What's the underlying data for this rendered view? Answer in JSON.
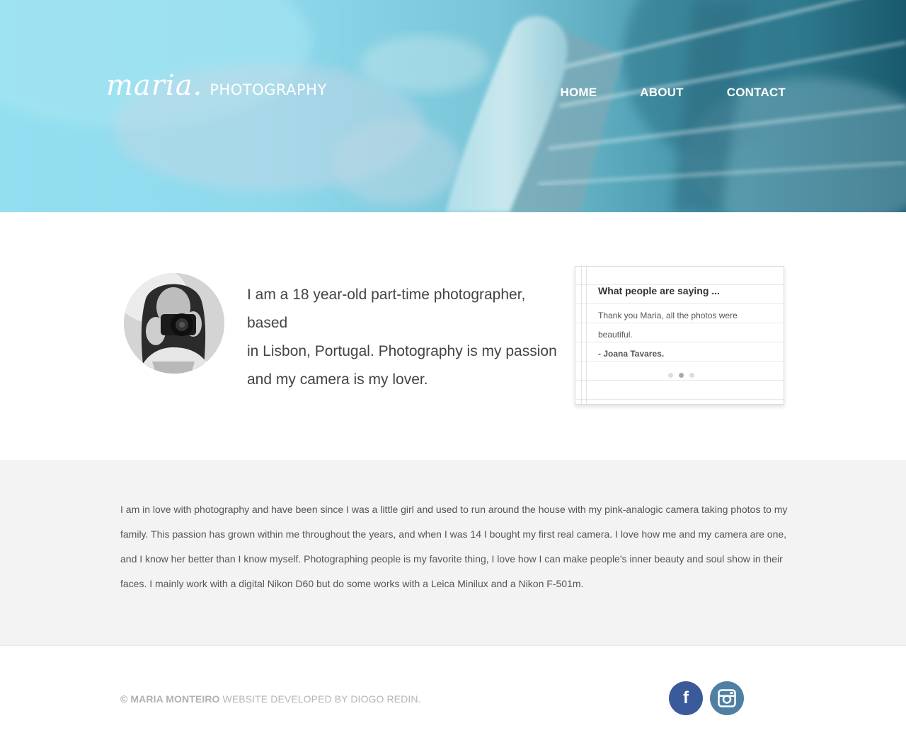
{
  "brand": {
    "script": "maria.",
    "word": "PHOTOGRAPHY"
  },
  "nav": {
    "items": [
      {
        "label": "HOME"
      },
      {
        "label": "ABOUT"
      },
      {
        "label": "CONTACT"
      }
    ]
  },
  "intro": {
    "line1": "I am a 18 year-old part-time photographer, based",
    "line2": "in Lisbon, Portugal. Photography is my passion",
    "line3": "and my camera is my lover."
  },
  "testimonial": {
    "title": "What people are saying ...",
    "quote": "Thank you Maria, all the photos were beautiful.",
    "author": "- Joana Tavares.",
    "slides": 3,
    "active_slide": 2
  },
  "about": {
    "text": "I am in love with photography and have been since I was a little girl and used to run around the house with my pink-analogic camera taking photos to my family. This passion has grown within me throughout the years, and when I was 14 I bought my first real camera. I love how me and my camera are one, and I know her better than I know myself. Photographing people is my favorite thing, I love how I can make people's inner beauty and soul show in their faces. I mainly work with a digital Nikon D60 but do some works with a Leica Minilux and a Nikon F-501m."
  },
  "footer": {
    "copyright_symbol": "©",
    "owner": "MARIA MONTEIRO",
    "credit": "WEBSITE DEVELOPED BY DIOGO REDIN."
  },
  "social": [
    {
      "name": "facebook",
      "icon": "facebook-icon",
      "glyph": "f",
      "color": "#3b5a9c"
    },
    {
      "name": "instagram",
      "icon": "instagram-icon",
      "color": "#4f7fa3"
    }
  ],
  "colors": {
    "hero_light": "#93dff0",
    "hero_dark": "#19596d",
    "about_bg": "#f3f3f3",
    "text": "#555555"
  }
}
